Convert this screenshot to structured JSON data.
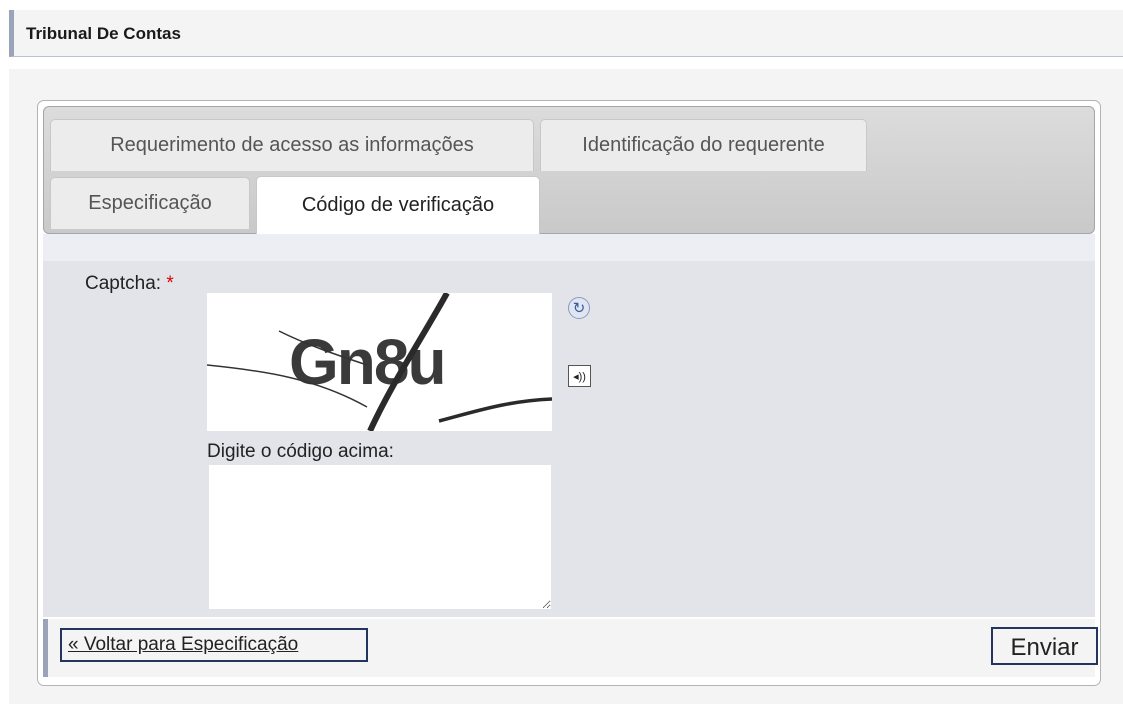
{
  "header": {
    "title": "Tribunal De Contas"
  },
  "tabs": [
    {
      "label": "Requerimento de acesso as informações",
      "active": false
    },
    {
      "label": "Identificação do requerente",
      "active": false
    },
    {
      "label": "Especificação",
      "active": false
    },
    {
      "label": "Código de verificação",
      "active": true
    }
  ],
  "form": {
    "captcha_label": "Captcha:",
    "required_marker": "*",
    "captcha_code": "Gn8u",
    "input_label": "Digite o código acima:",
    "input_value": "",
    "refresh_icon": "refresh-icon",
    "audio_icon": "speaker-icon"
  },
  "footer": {
    "back_label": "« Voltar para Especificação",
    "submit_label": "Enviar"
  },
  "colors": {
    "required": "#e00000",
    "accent_bar": "#9aa3b8",
    "button_border": "#23345e"
  }
}
